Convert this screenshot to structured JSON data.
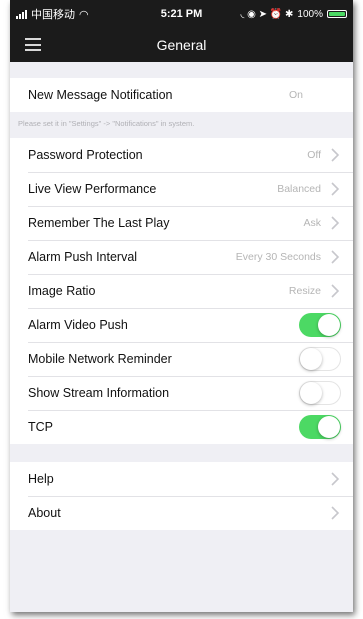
{
  "status_bar": {
    "carrier": "中国移动",
    "time": "5:21 PM",
    "indicators": "◟ ◉ ➤ ⏰ ✱",
    "battery_percent": "100%",
    "battery_level": 1.0,
    "signal_icon": "cellular-signal-icon",
    "wifi_icon": "wifi-icon"
  },
  "nav": {
    "title": "General",
    "menu_icon": "hamburger-menu-icon"
  },
  "notification": {
    "label": "New Message Notification",
    "value": "On",
    "hint": "Please set it in \"Settings\" -> \"Notifications\" in system."
  },
  "settings": {
    "password": {
      "label": "Password Protection",
      "value": "Off"
    },
    "live_view": {
      "label": "Live View Performance",
      "value": "Balanced"
    },
    "remember_play": {
      "label": "Remember The Last Play",
      "value": "Ask"
    },
    "alarm_interval": {
      "label": "Alarm Push Interval",
      "value": "Every 30 Seconds"
    },
    "image_ratio": {
      "label": "Image Ratio",
      "value": "Resize"
    },
    "alarm_video_push": {
      "label": "Alarm Video Push",
      "on": true
    },
    "mobile_reminder": {
      "label": "Mobile Network Reminder",
      "on": false
    },
    "stream_info": {
      "label": "Show Stream Information",
      "on": false
    },
    "tcp": {
      "label": "TCP",
      "on": true
    }
  },
  "about_group": {
    "help": {
      "label": "Help"
    },
    "about": {
      "label": "About"
    }
  },
  "colors": {
    "toggle_on": "#4cd964",
    "header_bg": "#1b1b1b",
    "page_bg": "#efeff4"
  }
}
